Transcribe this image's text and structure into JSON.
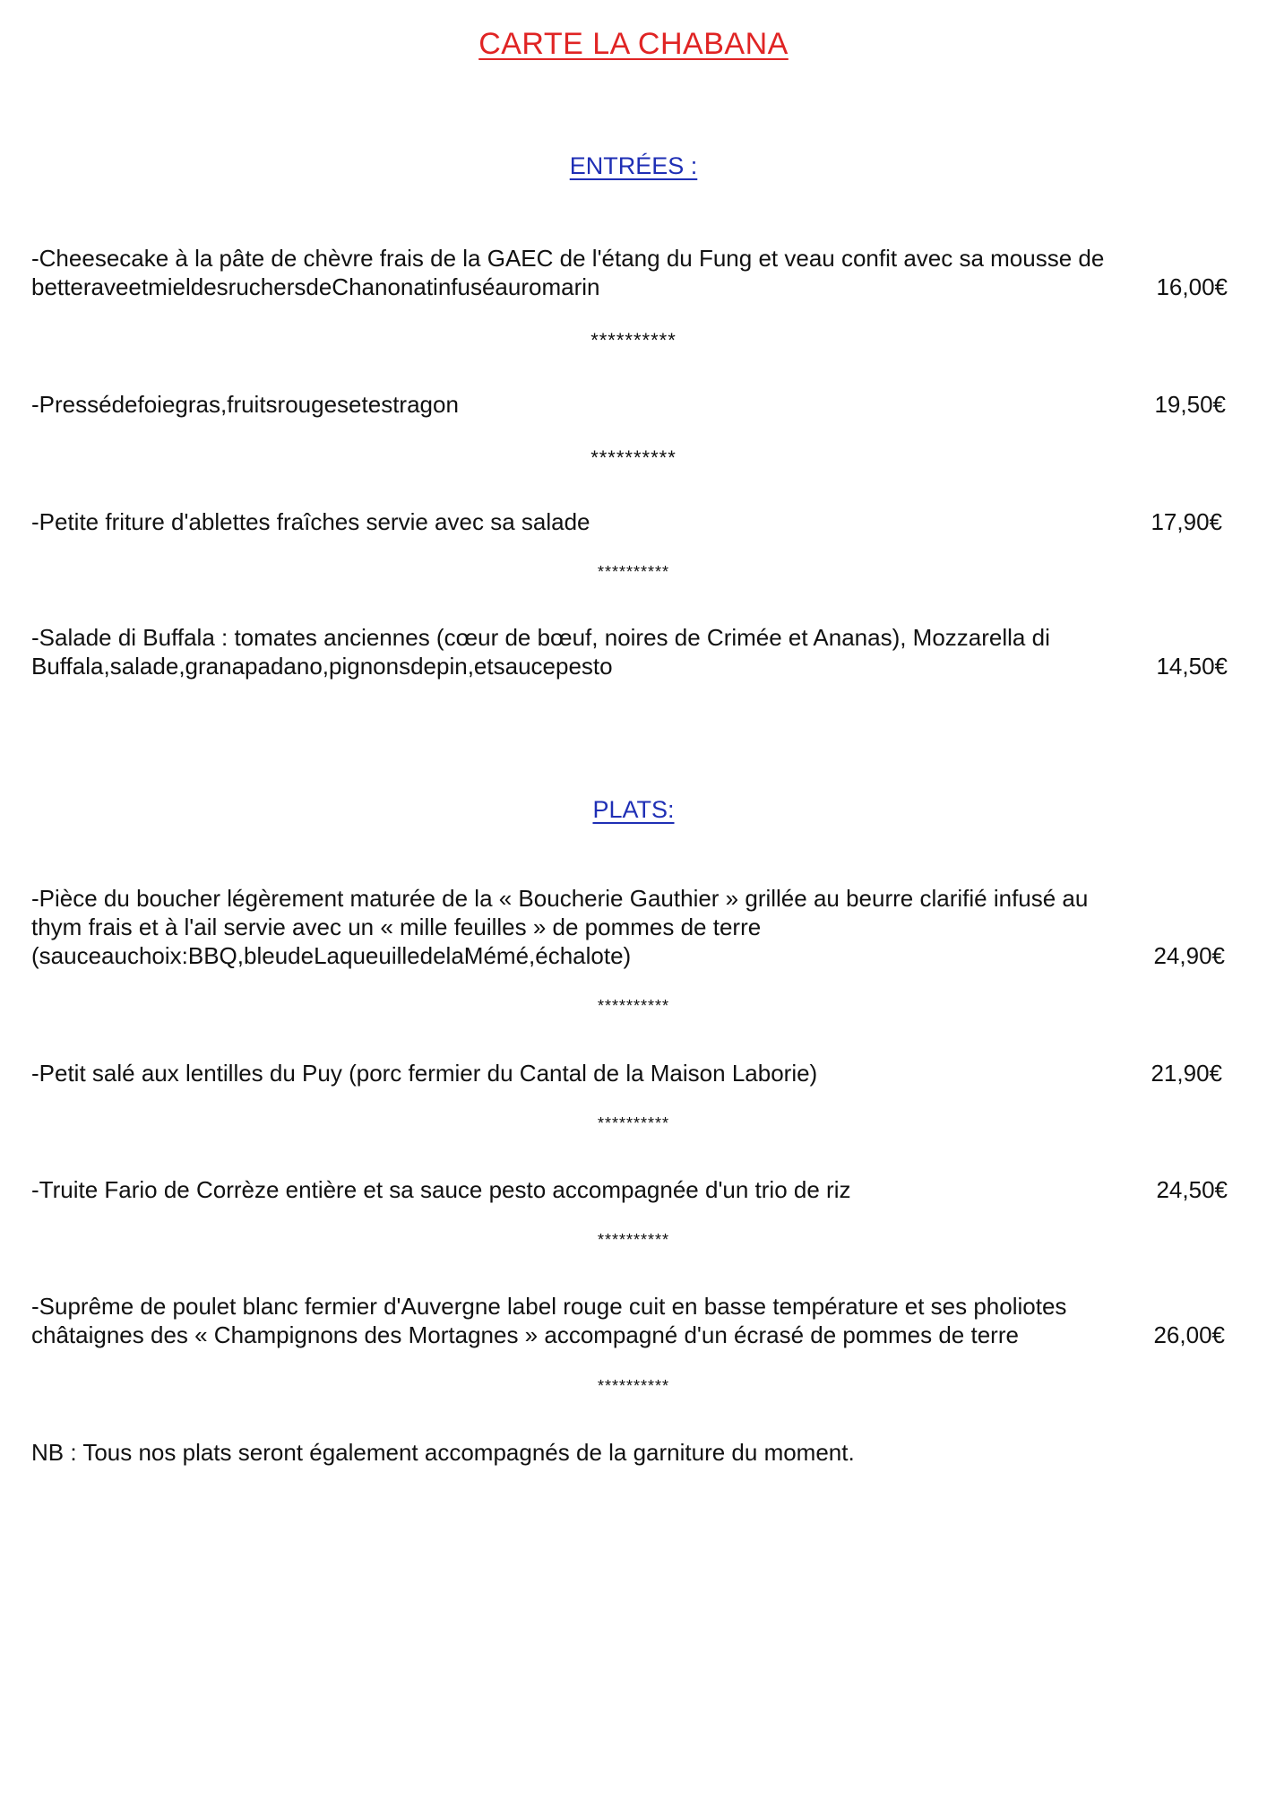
{
  "title": "CARTE LA CHABANA",
  "separator": "**********",
  "entrees": {
    "heading": "ENTRÉES :",
    "items": [
      {
        "lines": [
          "-Cheesecake à la pâte de chèvre frais de la GAEC de l'étang du Fung et veau confit avec sa mousse de",
          "betteraveetmieldesruchersdeChanonatinfuséauromarin"
        ],
        "price": "16,00€"
      },
      {
        "lines": [
          "-Pressédefoiegras,fruitsrougesetestragon"
        ],
        "price": "19,50€"
      },
      {
        "lines": [
          "-Petite friture d'ablettes fraîches servie avec sa salade"
        ],
        "price": "17,90€"
      },
      {
        "lines": [
          "-Salade di Buffala : tomates anciennes (cœur de bœuf, noires de Crimée et Ananas), Mozzarella di",
          "Buffala,salade,granapadano,pignonsdepin,etsaucepesto"
        ],
        "price": "14,50€"
      }
    ]
  },
  "plats": {
    "heading": "PLATS: ",
    "items": [
      {
        "lines": [
          "-Pièce du boucher légèrement maturée de la « Boucherie Gauthier » grillée au beurre clarifié infusé au",
          "thym frais et à l'ail servie avec un « mille feuilles » de pommes de terre",
          "(sauceauchoix:BBQ,bleudeLaqueuilledelaMémé,échalote)"
        ],
        "price": "24,90€"
      },
      {
        "lines": [
          "-Petit salé aux lentilles du Puy (porc fermier du Cantal de la Maison Laborie)"
        ],
        "price": "21,90€"
      },
      {
        "lines": [
          "-Truite Fario de Corrèze entière et sa sauce pesto accompagnée d'un trio de riz"
        ],
        "price": "24,50€"
      },
      {
        "lines": [
          "-Suprême de poulet blanc fermier d'Auvergne label rouge cuit en basse température et ses pholiotes",
          "châtaignes des « Champignons des Mortagnes » accompagné d'un écrasé de pommes de terre"
        ],
        "price": "26,00€"
      }
    ]
  },
  "note": "NB : Tous nos plats seront également accompagnés de la garniture du moment."
}
